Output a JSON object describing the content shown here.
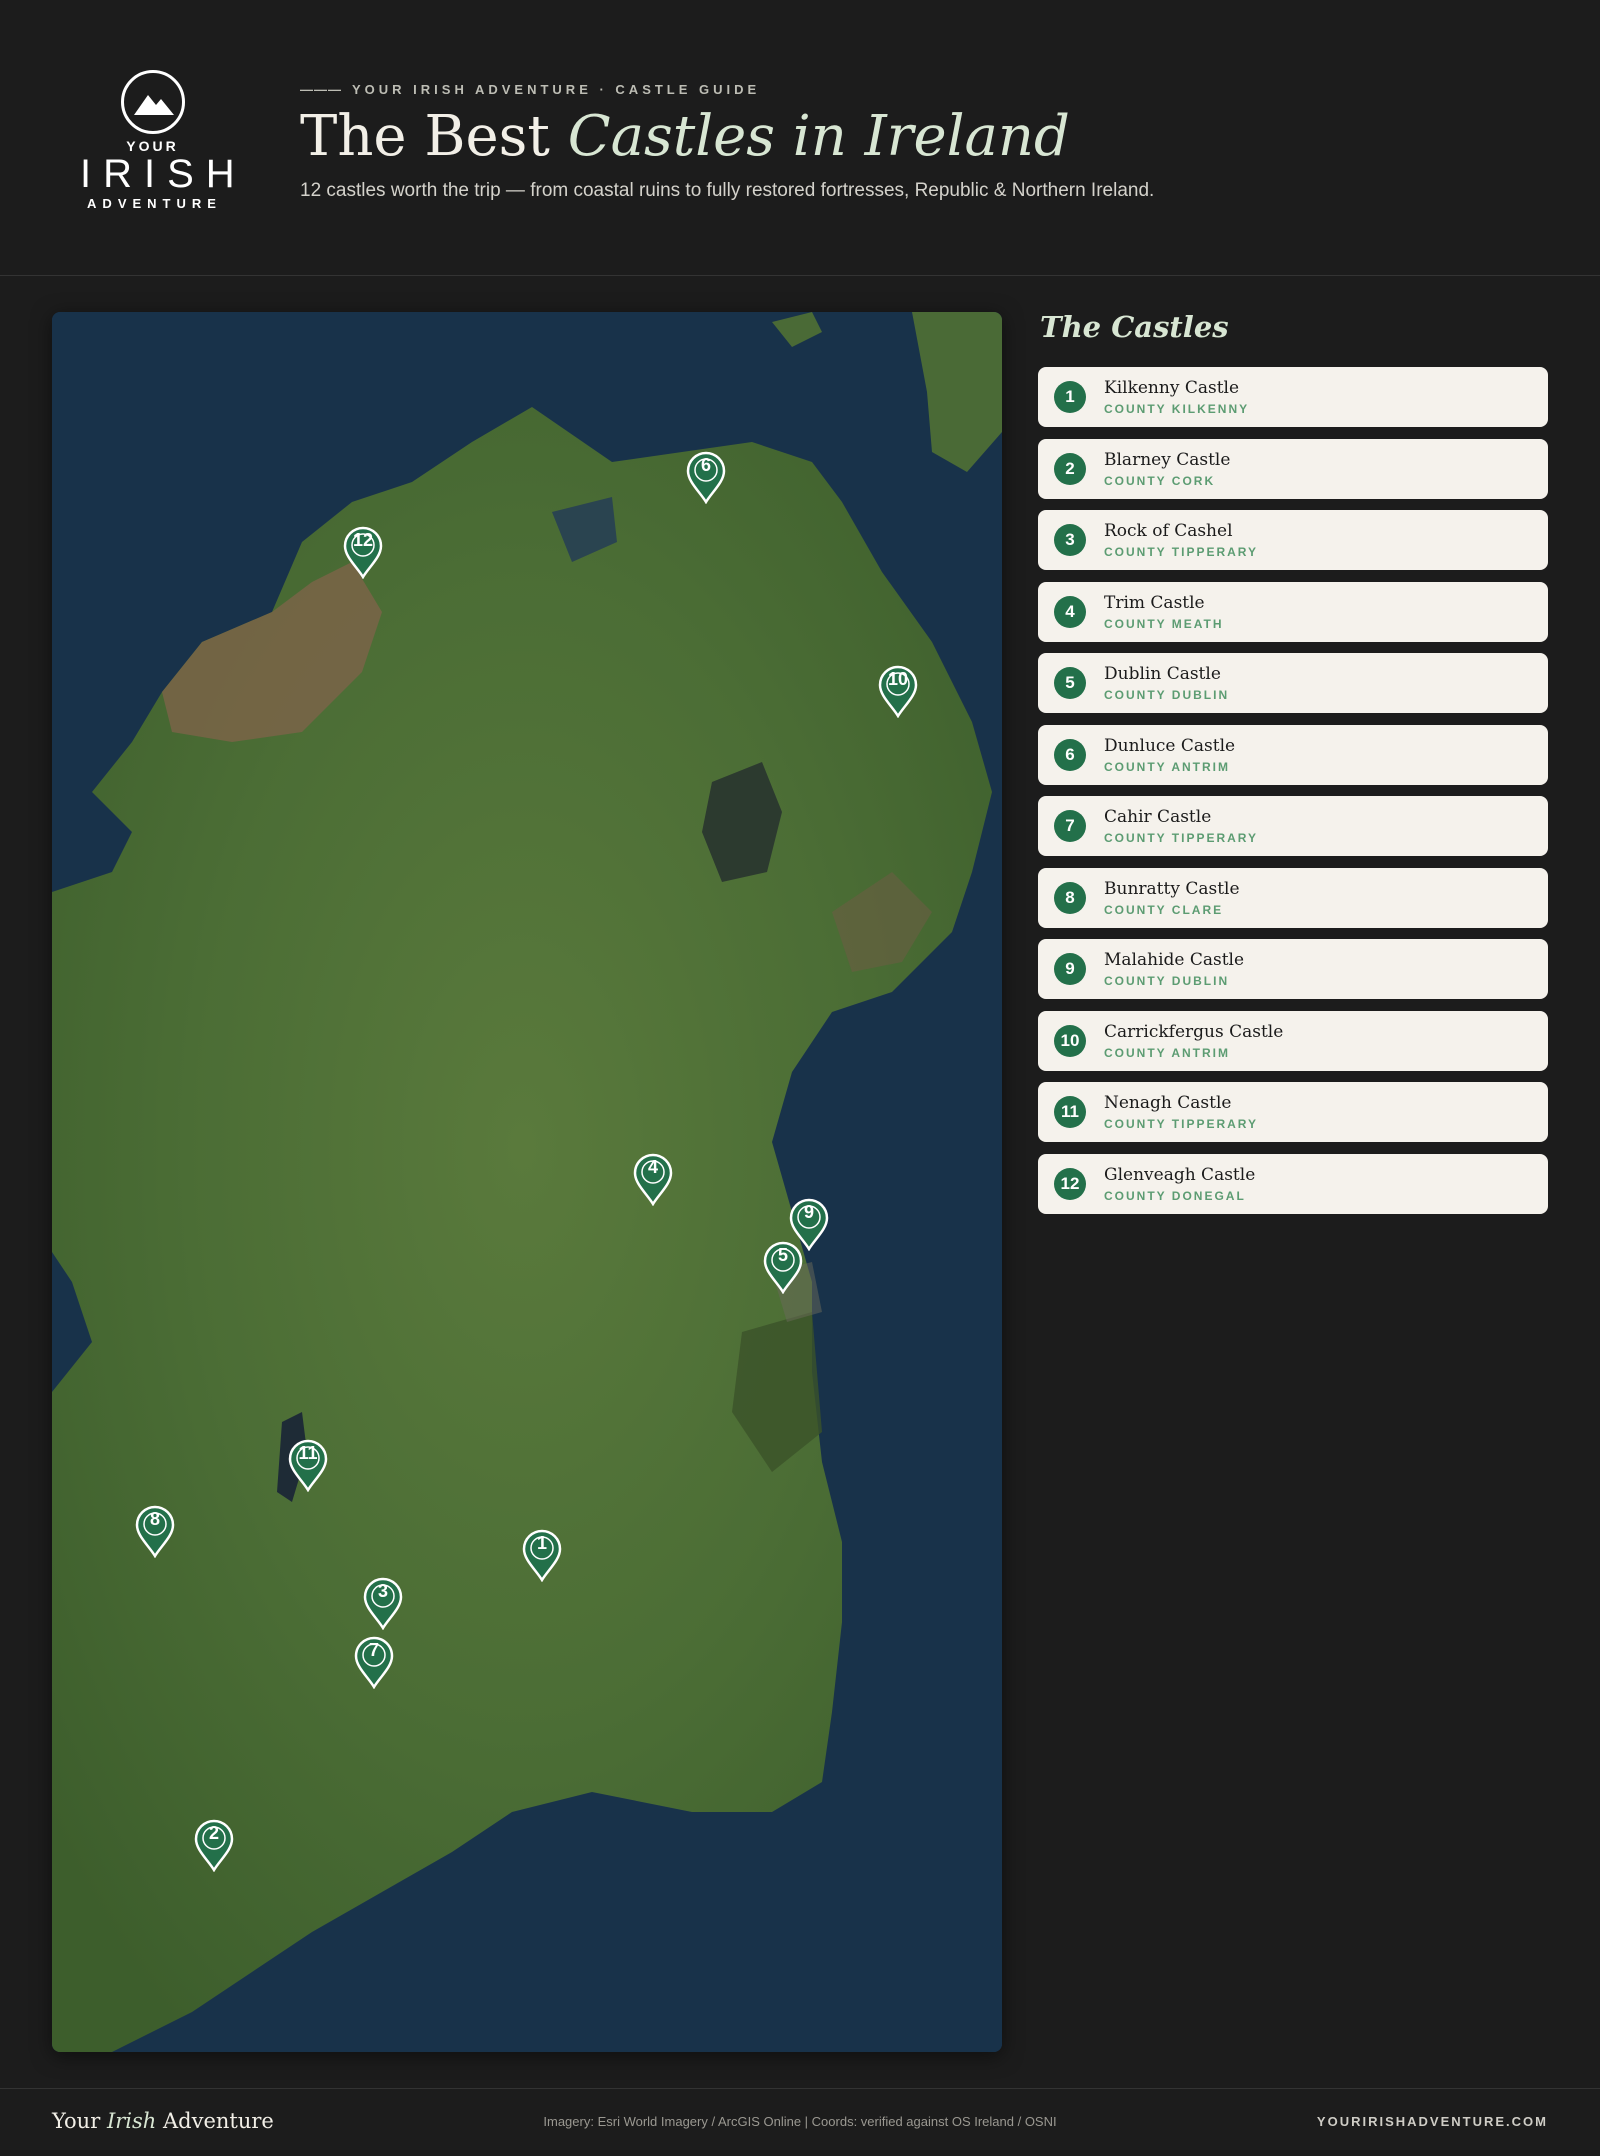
{
  "brand": {
    "logo_top": "YOUR",
    "logo_main": "IRISH",
    "logo_bottom": "ADVENTURE"
  },
  "header": {
    "dash": "———",
    "eyebrow": "YOUR IRISH ADVENTURE · CASTLE GUIDE",
    "title_plain": "The Best",
    "title_italic": "Castles in Ireland",
    "subtitle": "12 castles worth the trip — from coastal ruins to fully restored fortresses, Republic & Northern Ireland."
  },
  "map": {
    "basemap": "satellite imagery",
    "marker_color": "#23704a",
    "markers": [
      {
        "num": "1"
      },
      {
        "num": "2"
      },
      {
        "num": "3"
      },
      {
        "num": "4"
      },
      {
        "num": "5"
      },
      {
        "num": "6"
      },
      {
        "num": "7"
      },
      {
        "num": "8"
      },
      {
        "num": "9"
      },
      {
        "num": "10"
      },
      {
        "num": "11"
      },
      {
        "num": "12"
      }
    ]
  },
  "castles": {
    "heading": "The Castles",
    "items": [
      {
        "num": "1",
        "name": "Kilkenny Castle",
        "county": "COUNTY KILKENNY"
      },
      {
        "num": "2",
        "name": "Blarney Castle",
        "county": "COUNTY CORK"
      },
      {
        "num": "3",
        "name": "Rock of Cashel",
        "county": "COUNTY TIPPERARY"
      },
      {
        "num": "4",
        "name": "Trim Castle",
        "county": "COUNTY MEATH"
      },
      {
        "num": "5",
        "name": "Dublin Castle",
        "county": "COUNTY DUBLIN"
      },
      {
        "num": "6",
        "name": "Dunluce Castle",
        "county": "COUNTY ANTRIM"
      },
      {
        "num": "7",
        "name": "Cahir Castle",
        "county": "COUNTY TIPPERARY"
      },
      {
        "num": "8",
        "name": "Bunratty Castle",
        "county": "COUNTY CLARE"
      },
      {
        "num": "9",
        "name": "Malahide Castle",
        "county": "COUNTY DUBLIN"
      },
      {
        "num": "10",
        "name": "Carrickfergus Castle",
        "county": "COUNTY ANTRIM"
      },
      {
        "num": "11",
        "name": "Nenagh Castle",
        "county": "COUNTY TIPPERARY"
      },
      {
        "num": "12",
        "name": "Glenveagh Castle",
        "county": "COUNTY DONEGAL"
      }
    ]
  },
  "footer": {
    "brand_a": "Your",
    "brand_b": "Irish",
    "brand_c": "Adventure",
    "credit": "Imagery: Esri World Imagery / ArcGIS Online | Coords: verified against OS Ireland / OSNI",
    "url": "YOURIRISHADVENTURE.COM"
  }
}
